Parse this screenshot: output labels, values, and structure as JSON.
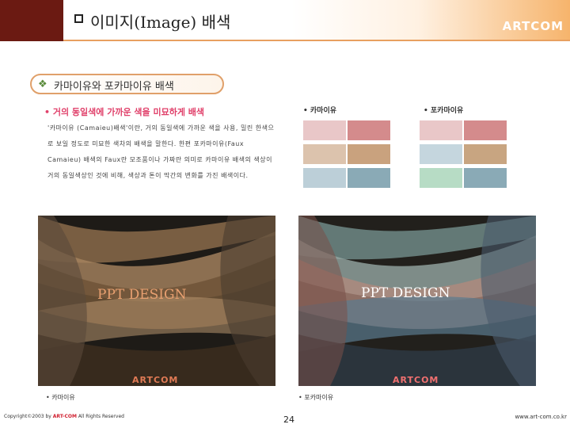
{
  "header": {
    "title": "이미지(Image) 배색",
    "brand": "ARTCOM"
  },
  "subtitle": "카마이유와 포카마이유 배색",
  "section": {
    "heading": "• 거의 동일색에 가까운 색을 미묘하게 배색",
    "body": "'카마이유 (Camaieu)배색'이란, 거의 동일색에 가까운 색을 사용, 밀린 한색으로 보일 정도로 미묘한 색차의 배색을 말한다. 한편 포카마이유(Faux Camaieu) 배색의 Faux란 모조품이나 가짜란 의미로 카마이유 배색의 색상이 거의 동일색상인 것에 비해, 색상과 톤이 막간의 변화를 가진 배색이다."
  },
  "swatches": {
    "camaieu_label": "• 카마이유",
    "faux_label": "• 포카마이유",
    "camaieu_colors": [
      [
        "#e9c7c8",
        "#d48b8c"
      ],
      [
        "#dcc3ad",
        "#c9a27e"
      ],
      [
        "#bccfd8",
        "#8aaab6"
      ]
    ],
    "faux_colors": [
      [
        "#e9c7c8",
        "#d48b8c"
      ],
      [
        "#c5d6de",
        "#c8a581"
      ],
      [
        "#b7dcc5",
        "#8aaab6"
      ]
    ]
  },
  "images": {
    "left": {
      "title": "PPT DESIGN",
      "brand": "ARTCOM",
      "caption": "• 카마이유"
    },
    "right": {
      "title": "PPT DESIGN",
      "brand": "ARTCOM",
      "caption": "• 포카마이유"
    }
  },
  "footer": {
    "copyright_pre": "Copyright©2003 by ",
    "copyright_brand": "ART-COM",
    "copyright_post": " All Rights Reserved",
    "page_number": "24",
    "website": "www.art-com.co.kr"
  }
}
